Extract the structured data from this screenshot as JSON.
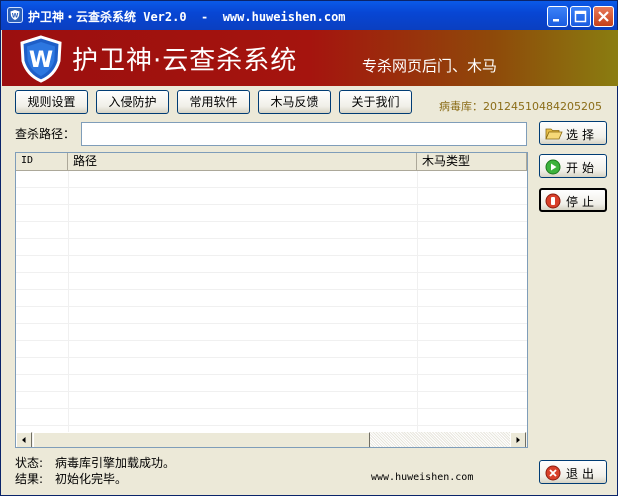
{
  "window": {
    "title": "护卫神・云查杀系统 Ver2.0  -  www.huweishen.com"
  },
  "banner": {
    "title": "护卫神·云查杀系统",
    "subtitle": "专杀网页后门、木马"
  },
  "toolbar": {
    "buttons": [
      {
        "label": "规则设置",
        "icon": "none"
      },
      {
        "label": "入侵防护",
        "icon": "none"
      },
      {
        "label": "常用软件",
        "icon": "none"
      },
      {
        "label": "木马反馈",
        "icon": "none"
      },
      {
        "label": "关于我们",
        "icon": "none"
      }
    ],
    "virus_db_label": "病毒库：",
    "virus_db_value": "20124510484205205"
  },
  "scan_path": {
    "label": "查杀路径：",
    "value": ""
  },
  "side_buttons": {
    "select": {
      "label": "选择",
      "icon": "folder-open-icon"
    },
    "start": {
      "label": "开始",
      "icon": "play-icon"
    },
    "stop": {
      "label": "停止",
      "icon": "stop-icon"
    },
    "exit": {
      "label": "退出",
      "icon": "close-circle-icon"
    }
  },
  "results_table": {
    "columns": [
      "ID",
      "路径",
      "木马类型"
    ],
    "rows": []
  },
  "status": {
    "status_label": "状态:",
    "status_value": "病毒库引擎加载成功。",
    "result_label": "结果:",
    "result_value": "初始化完毕。",
    "footer_url": "www.huweishen.com"
  },
  "colors": {
    "banner_red": "#9b0f0f",
    "virus_db_text": "#8b6d18",
    "titlebar_blue": "#0a4ad8"
  }
}
